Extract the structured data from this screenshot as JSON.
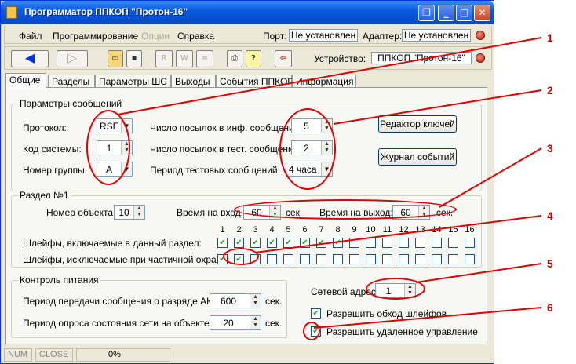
{
  "window": {
    "title": "Программатор ППКОП \"Протон-16\""
  },
  "menu": {
    "items": [
      {
        "label": "Файл",
        "enabled": true
      },
      {
        "label": "Программирование",
        "enabled": true
      },
      {
        "label": "Опции",
        "enabled": false
      },
      {
        "label": "Справка",
        "enabled": true
      }
    ],
    "port_label": "Порт:",
    "port_value": "Не установлен",
    "adapter_label": "Адаптер:",
    "adapter_value": "Не установлен"
  },
  "toolbar": {
    "device_label": "Устройство:",
    "device_value": "ППКОП \"Протон-16\"",
    "buttons": [
      "back-icon",
      "forward-icon",
      "open-folder-icon",
      "save-disk-icon",
      "read-icon",
      "write-icon",
      "verify-icon",
      "print-icon",
      "help-icon",
      "exit-icon"
    ]
  },
  "tabs": [
    "Общие",
    "Разделы",
    "Параметры ШС",
    "Выходы",
    "События ППКОП",
    "Информация"
  ],
  "active_tab": "Общие",
  "msg_params": {
    "title": "Параметры сообщений",
    "protocol_label": "Протокол:",
    "protocol_value": "RSE",
    "system_code_label": "Код системы:",
    "system_code_value": "1",
    "group_label": "Номер группы:",
    "group_value": "A",
    "info_count_label": "Число посылок в инф. сообщении:",
    "info_count_value": "5",
    "test_count_label": "Число посылок в тест. сообщении:",
    "test_count_value": "2",
    "test_period_label": "Период тестовых сообщений:",
    "test_period_value": "4 часа",
    "key_editor_button": "Редактор ключей",
    "event_log_button": "Журнал событий"
  },
  "section": {
    "title": "Раздел №1",
    "object_label": "Номер объекта:",
    "object_value": "10",
    "entry_label": "Время на вход:",
    "entry_value": "60",
    "entry_unit": "сек.",
    "exit_label": "Время на выход:",
    "exit_value": "60",
    "exit_unit": "сек.",
    "loops_included_label": "Шлейфы, включаемые в данный раздел:",
    "loops_partial_label": "Шлейфы, исключаемые при частичной охране:",
    "loop_numbers": [
      "1",
      "2",
      "3",
      "4",
      "5",
      "6",
      "7",
      "8",
      "9",
      "10",
      "11",
      "12",
      "13",
      "14",
      "15",
      "16"
    ],
    "loops_included": [
      true,
      true,
      true,
      true,
      true,
      true,
      true,
      true,
      false,
      false,
      false,
      false,
      false,
      false,
      false,
      false
    ],
    "loops_partial": [
      true,
      true,
      false,
      false,
      false,
      false,
      false,
      false,
      false,
      false,
      false,
      false,
      false,
      false,
      false,
      false
    ]
  },
  "power": {
    "title": "Контроль питания",
    "akb_label": "Период передачи сообщения о разряде АКБ:",
    "akb_value": "600",
    "akb_unit": "сек.",
    "net_label": "Период опроса состояния сети на объекте:",
    "net_value": "20",
    "net_unit": "сек."
  },
  "network": {
    "address_label": "Сетевой адрес:",
    "address_value": "1",
    "bypass_label": "Разрешить обход шлейфов",
    "bypass_checked": true,
    "remote_label": "Разрешить удаленное управление",
    "remote_checked": true
  },
  "statusbar": {
    "num": "NUM",
    "close": "CLOSE",
    "progress": "0%"
  },
  "annotations": [
    "1",
    "2",
    "3",
    "4",
    "5",
    "6"
  ],
  "colors": {
    "annotation": "#e00000",
    "titlebar": "#0a5ce0",
    "led": "#c02010",
    "check": "#21a121"
  }
}
